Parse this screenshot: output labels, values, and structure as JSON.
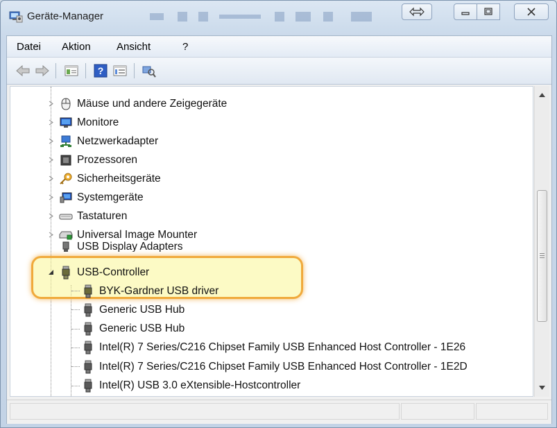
{
  "window": {
    "title": "Geräte-Manager"
  },
  "menu": {
    "items": [
      "Datei",
      "Aktion",
      "Ansicht",
      "?"
    ]
  },
  "toolbar": {
    "icons": [
      "back-arrow-icon",
      "forward-arrow-icon",
      "properties-icon",
      "help-icon",
      "view-icon",
      "scan-hardware-icon"
    ]
  },
  "tree": {
    "categories": [
      {
        "label": "Mäuse und andere Zeigegeräte",
        "icon": "mouse-icon"
      },
      {
        "label": "Monitore",
        "icon": "monitor-icon"
      },
      {
        "label": "Netzwerkadapter",
        "icon": "network-adapter-icon"
      },
      {
        "label": "Prozessoren",
        "icon": "processor-icon"
      },
      {
        "label": "Sicherheitsgeräte",
        "icon": "security-key-icon"
      },
      {
        "label": "Systemgeräte",
        "icon": "system-device-icon"
      },
      {
        "label": "Tastaturen",
        "icon": "keyboard-icon"
      },
      {
        "label": "Universal Image Mounter",
        "icon": "drive-icon"
      },
      {
        "label": "USB Display Adapters",
        "icon": "usb-plug-icon"
      }
    ],
    "expanded": {
      "label": "USB-Controller",
      "icon": "usb-plug-icon"
    },
    "children": [
      {
        "label": "BYK-Gardner USB driver"
      },
      {
        "label": "Generic USB Hub"
      },
      {
        "label": "Generic USB Hub"
      },
      {
        "label": "Intel(R) 7 Series/C216 Chipset Family USB Enhanced Host Controller - 1E26"
      },
      {
        "label": "Intel(R) 7 Series/C216 Chipset Family USB Enhanced Host Controller - 1E2D"
      },
      {
        "label": "Intel(R) USB 3.0 eXtensible-Hostcontroller"
      }
    ]
  },
  "colors": {
    "highlight_border": "#f0a93b",
    "highlight_fill": "#faf596"
  }
}
